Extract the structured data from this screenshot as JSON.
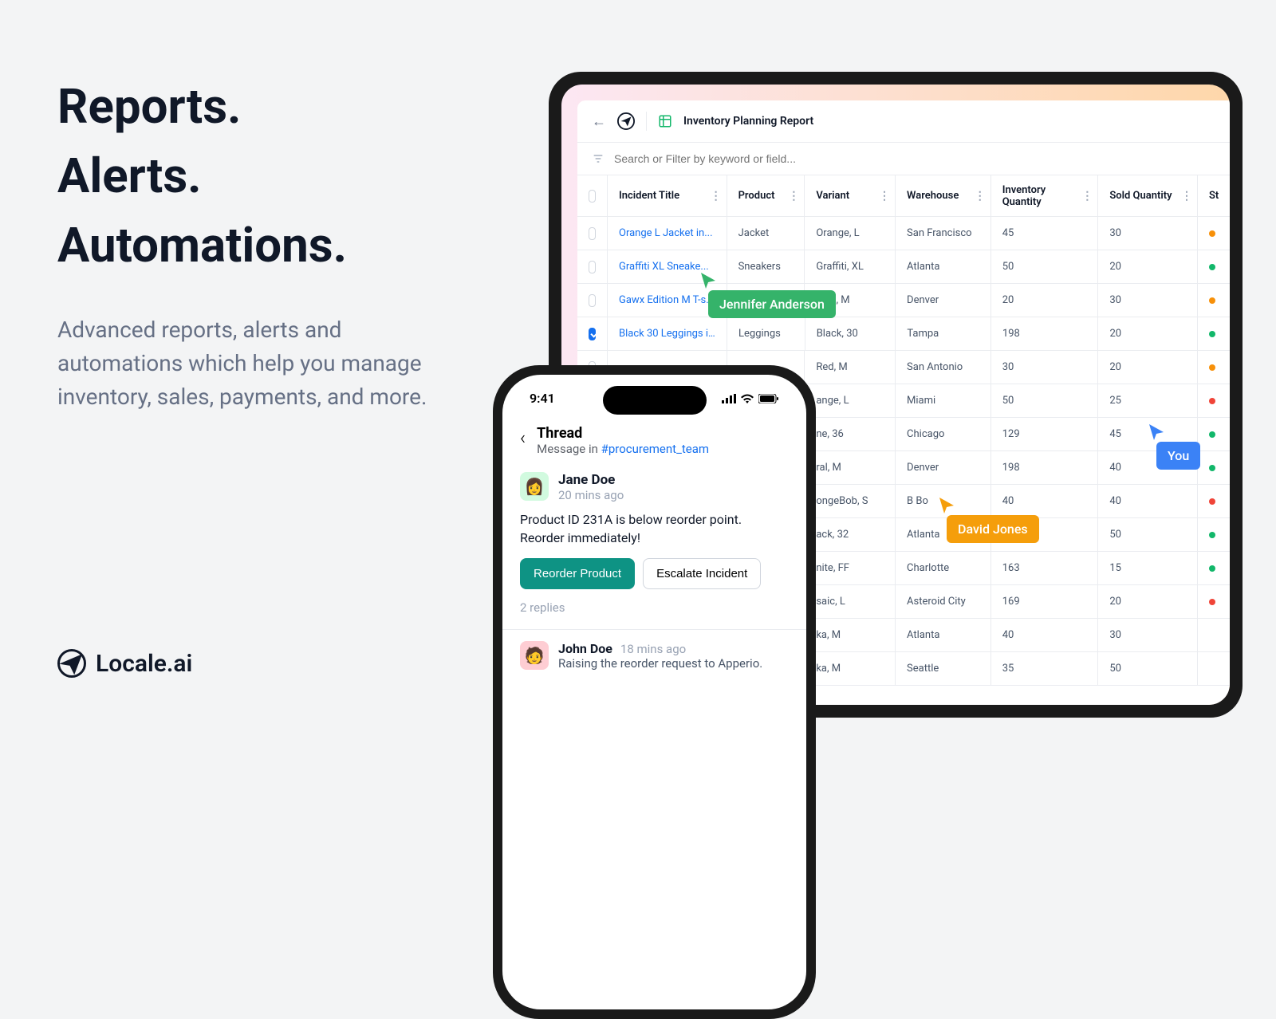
{
  "headline": {
    "line1": "Reports.",
    "line2": "Alerts.",
    "line3": "Automations."
  },
  "subtext": "Advanced reports, alerts and automations which help you manage inventory, sales, payments, and more.",
  "brand": "Locale.ai",
  "app": {
    "title": "Inventory Planning Report",
    "search_placeholder": "Search or Filter by keyword or field..."
  },
  "columns": [
    "Incident Title",
    "Product",
    "Variant",
    "Warehouse",
    "Inventory Quantity",
    "Sold Quantity",
    "St"
  ],
  "rows": [
    {
      "checked": false,
      "title": "Orange L Jacket in...",
      "product": "Jacket",
      "variant": "Orange, L",
      "warehouse": "San Francisco",
      "inv": "45",
      "sold": "30",
      "dot": "orange"
    },
    {
      "checked": false,
      "title": "Graffiti XL Sneake...",
      "product": "Sneakers",
      "variant": "Graffiti, XL",
      "warehouse": "Atlanta",
      "inv": "50",
      "sold": "20",
      "dot": "green"
    },
    {
      "checked": false,
      "title": "Gawx Edition M T-s...",
      "product": "",
      "variant": "ition, M",
      "warehouse": "Denver",
      "inv": "20",
      "sold": "30",
      "dot": "orange"
    },
    {
      "checked": true,
      "title": "Black 30 Leggings i...",
      "product": "Leggings",
      "variant": "Black, 30",
      "warehouse": "Tampa",
      "inv": "198",
      "sold": "20",
      "dot": "green"
    },
    {
      "checked": false,
      "title": "",
      "product": "",
      "variant": "Red, M",
      "warehouse": "San Antonio",
      "inv": "30",
      "sold": "20",
      "dot": "orange"
    },
    {
      "checked": false,
      "title": "",
      "product": "",
      "variant": "ange, L",
      "warehouse": "Miami",
      "inv": "50",
      "sold": "25",
      "dot": "red"
    },
    {
      "checked": false,
      "title": "",
      "product": "",
      "variant": "ne, 36",
      "warehouse": "Chicago",
      "inv": "129",
      "sold": "45",
      "dot": "green"
    },
    {
      "checked": false,
      "title": "",
      "product": "",
      "variant": "ral, M",
      "warehouse": "Denver",
      "inv": "198",
      "sold": "40",
      "dot": "green"
    },
    {
      "checked": false,
      "title": "",
      "product": "",
      "variant": "ongeBob, S",
      "warehouse": "B Bo",
      "inv": "40",
      "sold": "40",
      "dot": "red"
    },
    {
      "checked": false,
      "title": "",
      "product": "",
      "variant": "ack, 32",
      "warehouse": "Atlanta",
      "inv": "",
      "sold": "50",
      "dot": "green"
    },
    {
      "checked": false,
      "title": "",
      "product": "",
      "variant": "nite, FF",
      "warehouse": "Charlotte",
      "inv": "163",
      "sold": "15",
      "dot": "green"
    },
    {
      "checked": false,
      "title": "",
      "product": "",
      "variant": "saic, L",
      "warehouse": "Asteroid City",
      "inv": "169",
      "sold": "20",
      "dot": "red"
    },
    {
      "checked": false,
      "title": "",
      "product": "",
      "variant": "ka, M",
      "warehouse": "Atlanta",
      "inv": "40",
      "sold": "30",
      "dot": ""
    },
    {
      "checked": false,
      "title": "",
      "product": "",
      "variant": "ka, M",
      "warehouse": "Seattle",
      "inv": "35",
      "sold": "50",
      "dot": ""
    }
  ],
  "phone": {
    "time": "9:41",
    "thread_title": "Thread",
    "thread_sub_prefix": "Message in ",
    "thread_channel": "#procurement_team",
    "msg1_name": "Jane Doe",
    "msg1_time": "20 mins ago",
    "msg1_body": "Product ID 231A is below reorder point. Reorder immediately!",
    "btn_primary": "Reorder Product",
    "btn_secondary": "Escalate Incident",
    "replies": "2 replies",
    "msg2_name": "John Doe",
    "msg2_time": "18 mins ago",
    "msg2_body": "Raising the reorder request to Apperio."
  },
  "cursors": {
    "green": "Jennifer Anderson",
    "blue": "You",
    "orange": "David Jones"
  }
}
